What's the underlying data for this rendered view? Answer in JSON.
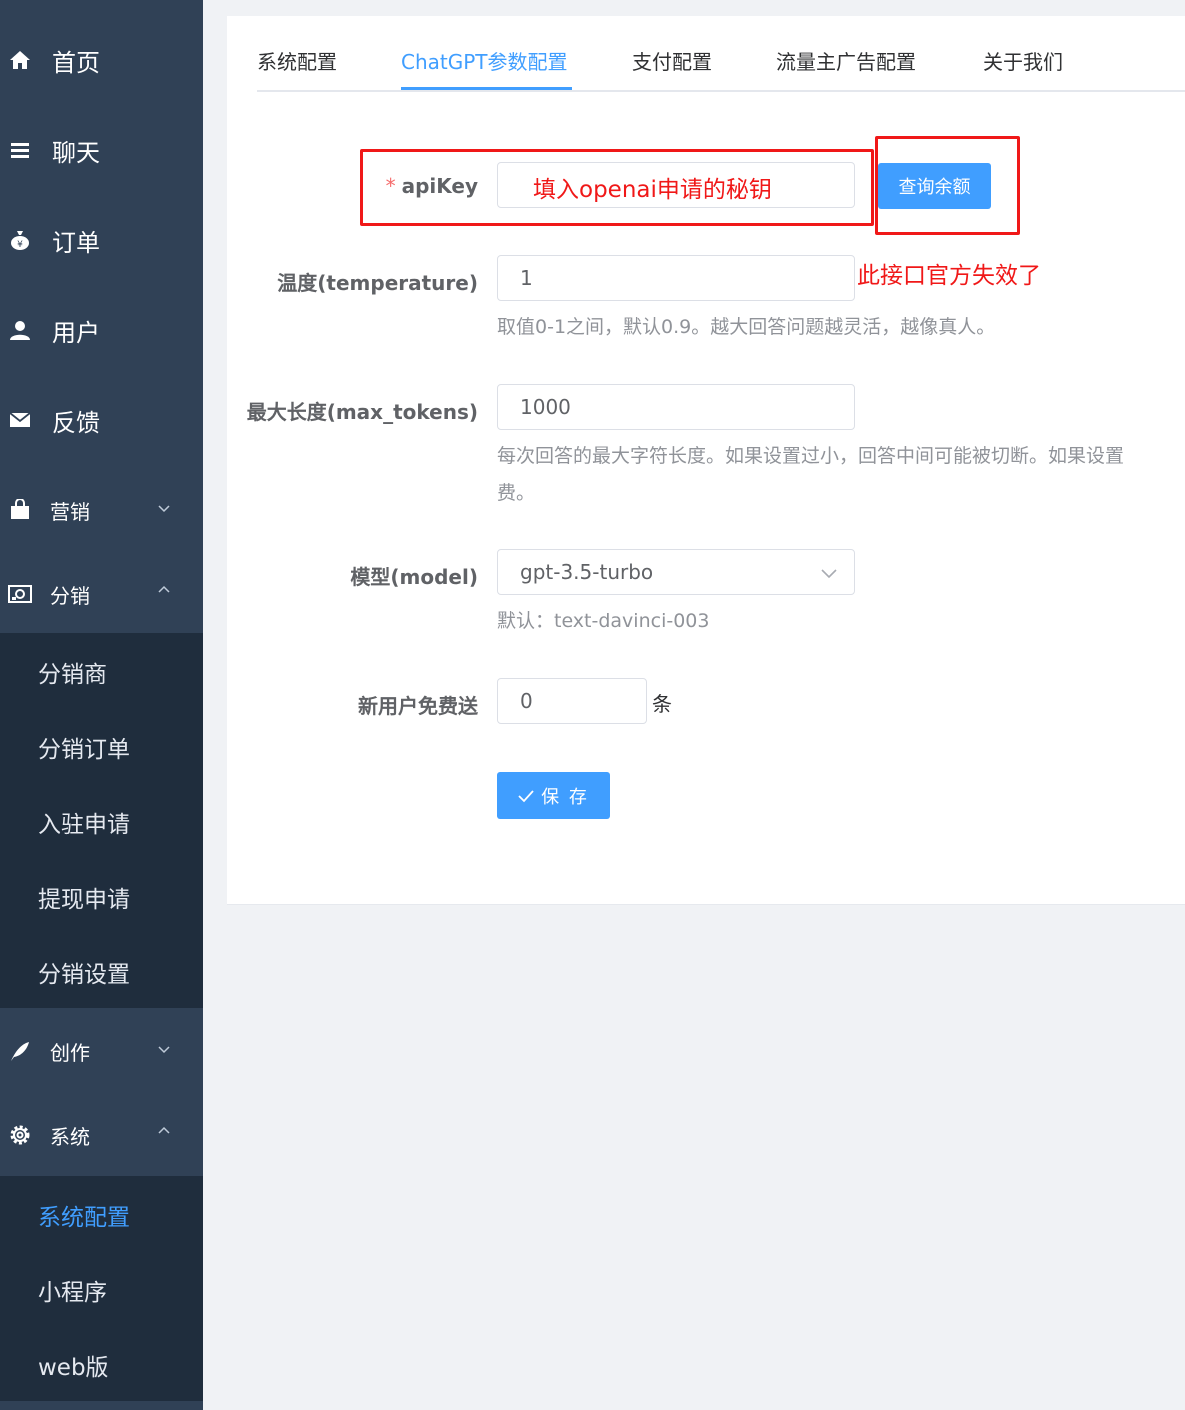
{
  "sidebar": {
    "items": [
      {
        "label": "首页",
        "icon": "home-icon"
      },
      {
        "label": "聊天",
        "icon": "list-icon"
      },
      {
        "label": "订单",
        "icon": "money-bag-icon"
      },
      {
        "label": "用户",
        "icon": "user-icon"
      },
      {
        "label": "反馈",
        "icon": "mail-icon"
      }
    ],
    "groups": [
      {
        "label": "营销",
        "icon": "shopping-bag-icon"
      },
      {
        "label": "分销",
        "icon": "distribution-icon"
      },
      {
        "label": "创作",
        "icon": "feather-icon"
      },
      {
        "label": "系统",
        "icon": "gear-icon"
      }
    ],
    "distribution_sub": [
      "分销商",
      "分销订单",
      "入驻申请",
      "提现申请",
      "分销设置"
    ],
    "system_sub": [
      "系统配置",
      "小程序",
      "web版"
    ]
  },
  "tabs": [
    "系统配置",
    "ChatGPT参数配置",
    "支付配置",
    "流量主广告配置",
    "关于我们"
  ],
  "active_tab": "ChatGPT参数配置",
  "form": {
    "apikey": {
      "required_mark": "*",
      "label": "apiKey",
      "value": "",
      "button": "查询余额"
    },
    "temperature": {
      "label": "温度(temperature)",
      "value": "1",
      "hint": "取值0-1之间，默认0.9。越大回答问题越灵活，越像真人。"
    },
    "max_tokens": {
      "label": "最大长度(max_tokens)",
      "value": "1000",
      "hint_line1": "每次回答的最大字符长度。如果设置过小，回答中间可能被切断。如果设置",
      "hint_line2": "费。"
    },
    "model": {
      "label": "模型(model)",
      "value": "gpt-3.5-turbo",
      "hint": "默认：text-davinci-003"
    },
    "free_messages": {
      "label": "新用户免费送",
      "value": "0",
      "unit": "条"
    },
    "save_label": "保 存"
  },
  "annotations": {
    "apikey_note": "填入openai申请的秘钥",
    "balance_note": "此接口官方失效了"
  },
  "colors": {
    "sidebar_bg": "#304156",
    "submenu_bg": "#1f2d3d",
    "accent": "#409eff",
    "annotation": "#f01818"
  }
}
